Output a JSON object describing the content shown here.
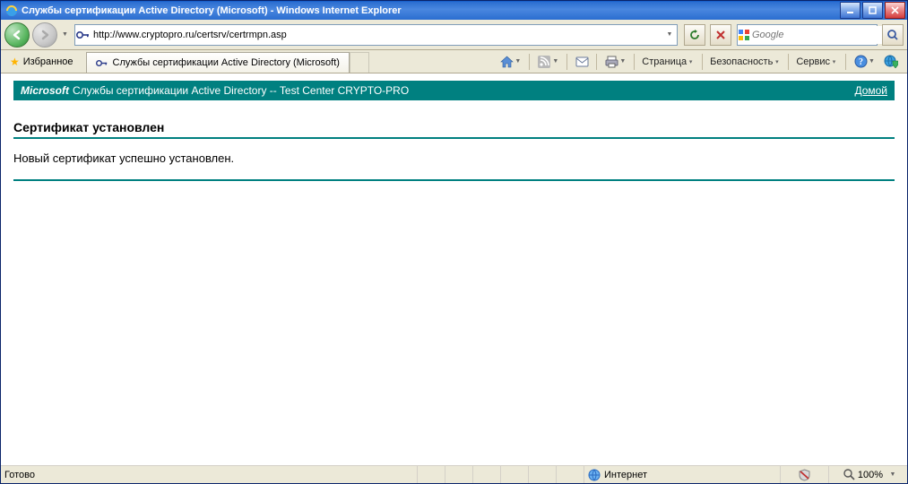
{
  "titlebar": {
    "title": "Службы сертификации Active Directory (Microsoft) - Windows Internet Explorer"
  },
  "nav": {
    "url": "http://www.cryptopro.ru/certsrv/certrmpn.asp",
    "search_placeholder": "Google"
  },
  "favbar": {
    "label": "Избранное",
    "tab_title": "Службы сертификации Active Directory (Microsoft)"
  },
  "cmdbar": {
    "page": "Страница",
    "safety": "Безопасность",
    "tools": "Сервис"
  },
  "page": {
    "band_ms": "Microsoft",
    "band_rest": " Службы сертификации Active Directory  --  Test Center CRYPTO-PRO",
    "home": "Домой",
    "heading": "Сертификат установлен",
    "message": "Новый сертификат успешно установлен."
  },
  "status": {
    "ready": "Готово",
    "zone": "Интернет",
    "protected": "",
    "zoom": "100%"
  },
  "colors": {
    "teal": "#008080"
  }
}
